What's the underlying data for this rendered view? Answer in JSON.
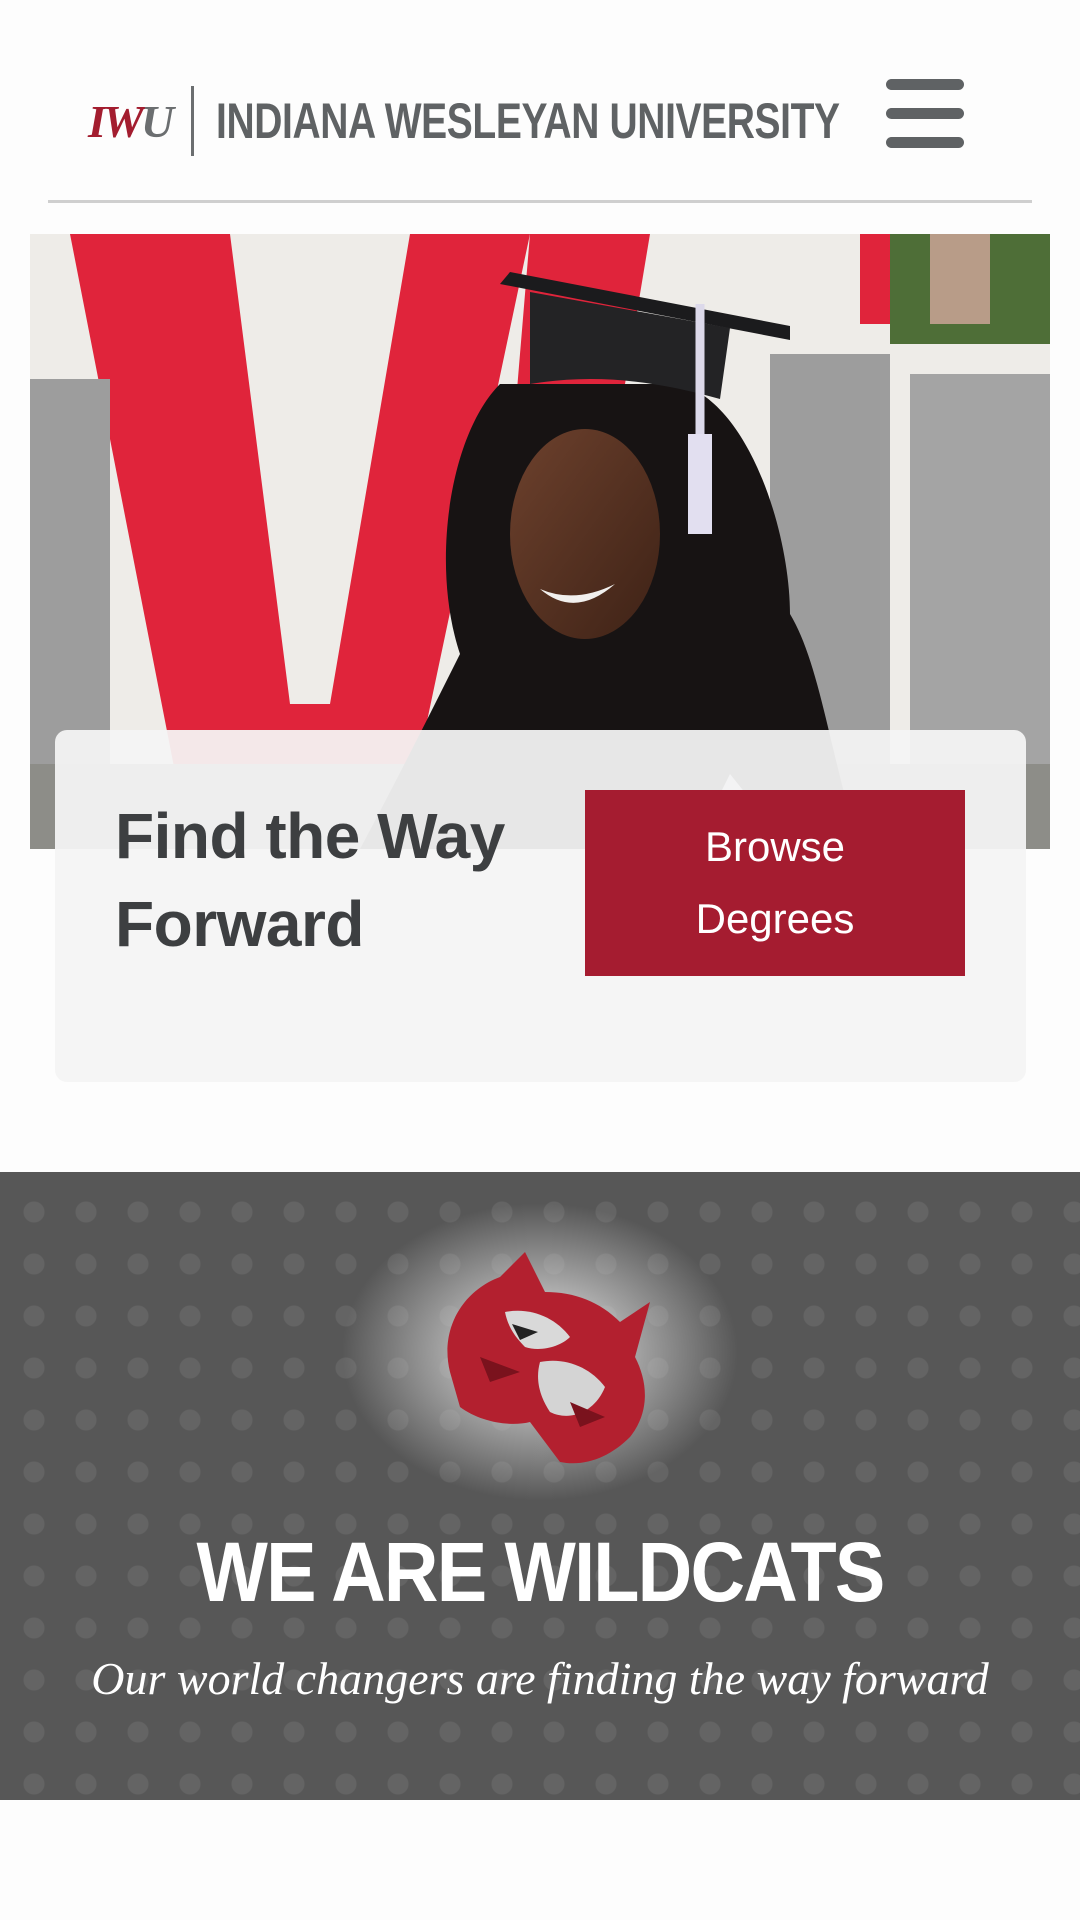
{
  "header": {
    "logo_mark": "IWU",
    "university_name": "INDIANA WESLEYAN UNIVERSITY"
  },
  "hero": {
    "title": "Find the Way Forward",
    "cta_label": "Browse Degrees"
  },
  "wildcats": {
    "title": "WE ARE WILDCATS",
    "subtitle": "Our world changers are finding the way forward"
  },
  "colors": {
    "brand_red": "#a51c30",
    "brand_gray": "#5f6264",
    "band_gray": "#575757"
  },
  "icons": [
    "menu-icon",
    "wildcat-mascot-icon"
  ]
}
